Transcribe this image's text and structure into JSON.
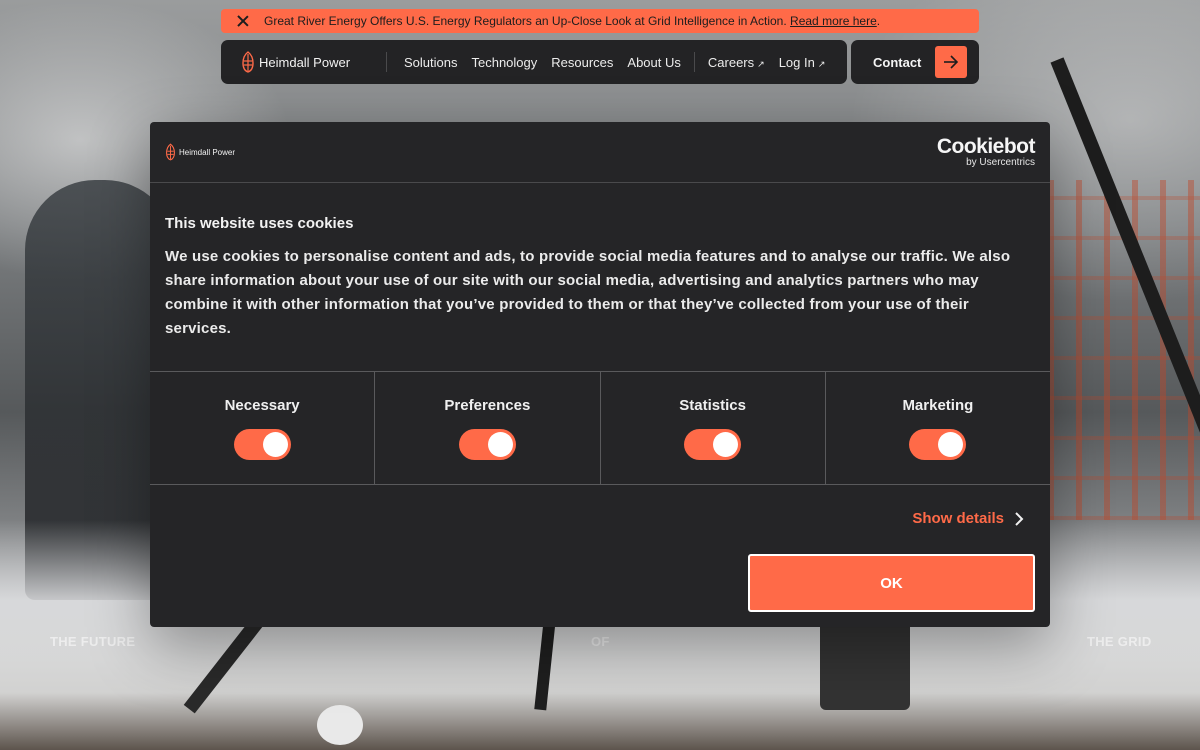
{
  "announcement": {
    "message": "Great River Energy Offers U.S. Energy Regulators an Up-Close Look at Grid Intelligence in Action.",
    "link_text": "Read more here",
    "trailing": "."
  },
  "nav": {
    "brand": "Heimdall Power",
    "items": [
      "Solutions",
      "Technology",
      "Resources",
      "About Us"
    ],
    "external": [
      {
        "label": "Careers",
        "icon": "external-arrow-icon"
      },
      {
        "label": "Log In",
        "icon": "external-arrow-icon"
      }
    ],
    "contact": "Contact",
    "external_glyph": "↗"
  },
  "hero": {
    "words": [
      "THE FUTURE",
      "OF",
      "THE GRID"
    ]
  },
  "cookie": {
    "brand": "Heimdall Power",
    "provider": "Cookiebot",
    "provider_sub": "by Usercentrics",
    "title": "This website uses cookies",
    "text": "We use cookies to personalise content and ads, to provide social media features and to analyse our traffic. We also share information about your use of our site with our social media, advertising and analytics partners who may combine it with other information that you’ve provided to them or that they’ve collected from your use of their services.",
    "categories": [
      {
        "label": "Necessary",
        "checked": true
      },
      {
        "label": "Preferences",
        "checked": true
      },
      {
        "label": "Statistics",
        "checked": true
      },
      {
        "label": "Marketing",
        "checked": true
      }
    ],
    "show_details": "Show details",
    "ok": "OK"
  },
  "colors": {
    "accent": "#ff6a48",
    "panel": "#252527",
    "nav_bg": "#232325"
  }
}
